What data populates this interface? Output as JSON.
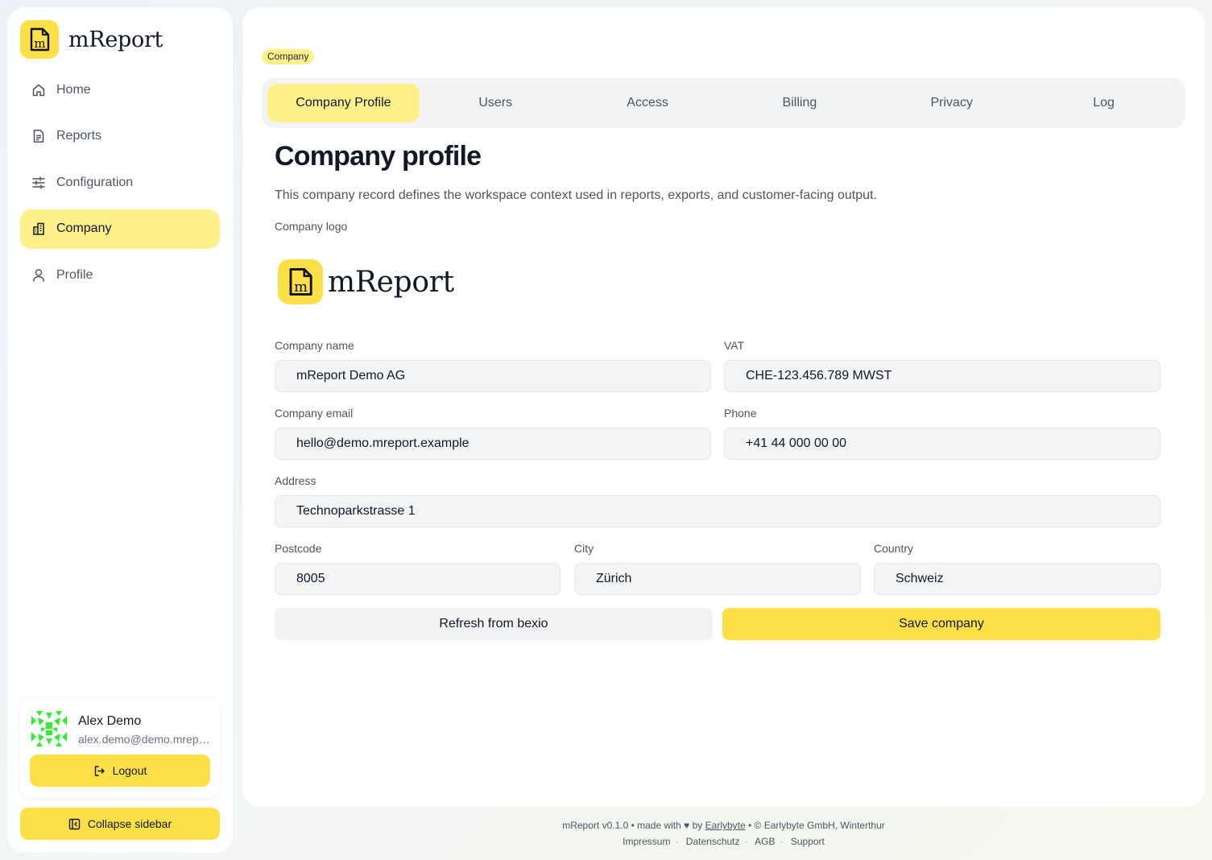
{
  "app": {
    "name": "mReport",
    "logo_letter": "m"
  },
  "sidebar": {
    "items": [
      {
        "label": "Home",
        "icon": "home-icon"
      },
      {
        "label": "Reports",
        "icon": "reports-icon"
      },
      {
        "label": "Configuration",
        "icon": "sliders-icon"
      },
      {
        "label": "Company",
        "icon": "building-icon",
        "active": true
      },
      {
        "label": "Profile",
        "icon": "user-icon"
      }
    ],
    "user": {
      "name": "Alex Demo",
      "email": "alex.demo@demo.mreport.example"
    },
    "logout_label": "Logout",
    "collapse_label": "Collapse sidebar"
  },
  "breadcrumb": "Company",
  "tabs": [
    {
      "label": "Company Profile",
      "active": true
    },
    {
      "label": "Users"
    },
    {
      "label": "Access"
    },
    {
      "label": "Billing"
    },
    {
      "label": "Privacy"
    },
    {
      "label": "Log"
    }
  ],
  "page": {
    "title": "Company profile",
    "description": "This company record defines the workspace context used in reports, exports, and customer-facing output.",
    "logo_label": "Company logo"
  },
  "form": {
    "company_name": {
      "label": "Company name",
      "value": "mReport Demo AG"
    },
    "vat": {
      "label": "VAT",
      "value": "CHE-123.456.789 MWST"
    },
    "email": {
      "label": "Company email",
      "value": "hello@demo.mreport.example"
    },
    "phone": {
      "label": "Phone",
      "value": "+41 44 000 00 00"
    },
    "address": {
      "label": "Address",
      "value": "Technoparkstrasse 1"
    },
    "postcode": {
      "label": "Postcode",
      "value": "8005"
    },
    "city": {
      "label": "City",
      "value": "Zürich"
    },
    "country": {
      "label": "Country",
      "value": "Schweiz"
    }
  },
  "actions": {
    "refresh_label": "Refresh from bexio",
    "save_label": "Save company"
  },
  "footer": {
    "made_with_prefix": "mReport v0.1.0 • made with ♥ by",
    "author_link": "Earlybyte",
    "copyright": "• © Earlybyte GmbH, Winterthur",
    "links": [
      "Impressum",
      "Datenschutz",
      "AGB",
      "Support"
    ]
  },
  "colors": {
    "accent": "#fde047",
    "accent_soft": "#fef08a",
    "avatar": "#2ef02e"
  }
}
